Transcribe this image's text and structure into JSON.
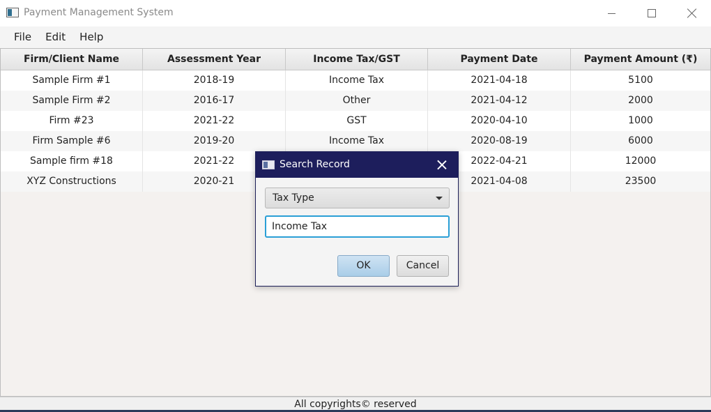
{
  "window": {
    "title": "Payment Management System"
  },
  "menu": {
    "items": [
      "File",
      "Edit",
      "Help"
    ]
  },
  "table": {
    "columns": [
      "Firm/Client Name",
      "Assessment Year",
      "Income Tax/GST",
      "Payment Date",
      "Payment Amount (₹)"
    ],
    "rows": [
      [
        "Sample Firm #1",
        "2018-19",
        "Income Tax",
        "2021-04-18",
        "5100"
      ],
      [
        "Sample Firm #2",
        "2016-17",
        "Other",
        "2021-04-12",
        "2000"
      ],
      [
        "Firm #23",
        "2021-22",
        "GST",
        "2020-04-10",
        "1000"
      ],
      [
        "Firm Sample #6",
        "2019-20",
        "Income Tax",
        "2020-08-19",
        "6000"
      ],
      [
        "Sample firm #18",
        "2021-22",
        "",
        "2022-04-21",
        "12000"
      ],
      [
        "XYZ Constructions",
        "2020-21",
        "",
        "2021-04-08",
        "23500"
      ]
    ]
  },
  "footer": {
    "text": "All copyrights© reserved"
  },
  "dialog": {
    "title": "Search Record",
    "combo_value": "Tax Type",
    "field_value": "Income Tax",
    "ok_label": "OK",
    "cancel_label": "Cancel"
  },
  "icons": {
    "app": "app-window-icon",
    "minimize": "minimize-icon",
    "maximize": "maximize-icon",
    "close": "close-icon",
    "dropdown": "chevron-down-icon"
  },
  "colors": {
    "dialog_titlebar": "#1d1e5c",
    "focus_border": "#2a9fd6",
    "ok_button": "#a9cde8"
  }
}
